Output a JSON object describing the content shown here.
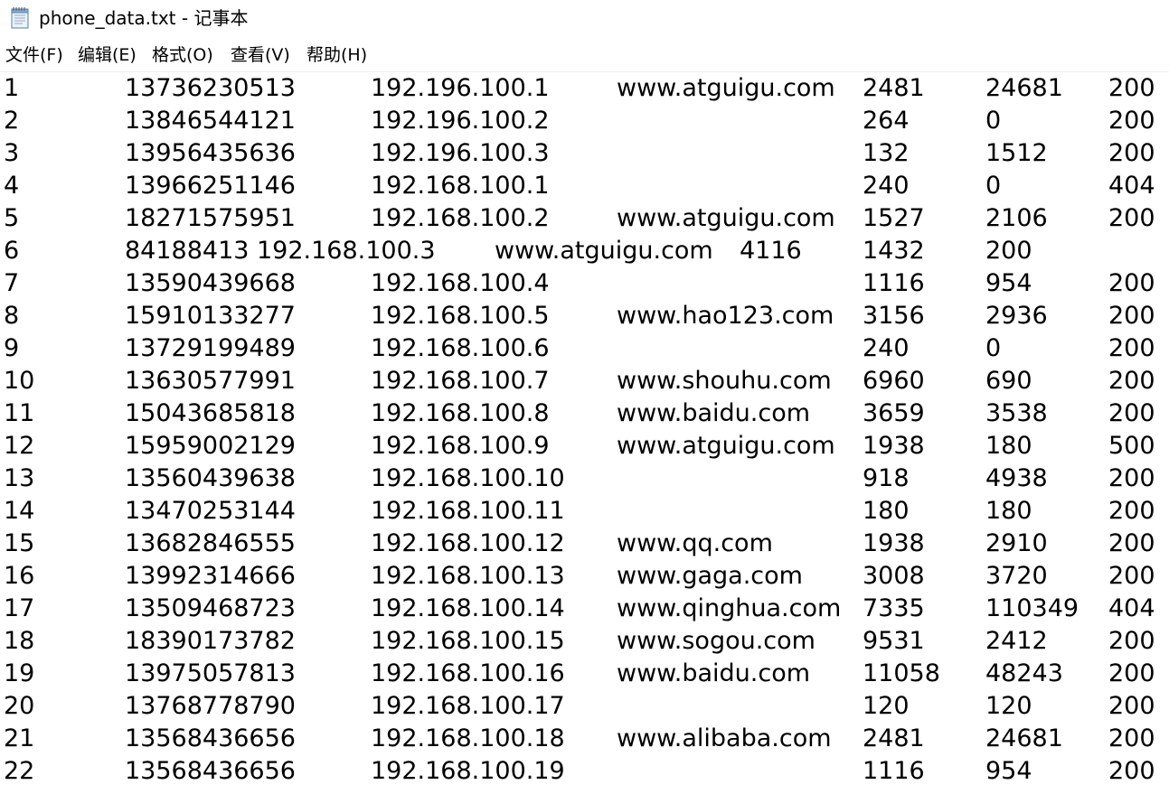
{
  "window": {
    "title": "phone_data.txt - 记事本",
    "icon": "notepad-icon"
  },
  "menu": {
    "items": [
      "文件(F)",
      "编辑(E)",
      "格式(O)",
      "查看(V)",
      "帮助(H)"
    ]
  },
  "content": {
    "rows": [
      [
        "1",
        "13736230513",
        "192.196.100.1",
        "www.atguigu.com",
        "2481",
        "24681",
        "200"
      ],
      [
        "2",
        "13846544121",
        "192.196.100.2",
        "",
        "264",
        "0",
        "200"
      ],
      [
        "3",
        "13956435636",
        "192.196.100.3",
        "",
        "132",
        "1512",
        "200"
      ],
      [
        "4",
        "13966251146",
        "192.168.100.1",
        "",
        "240",
        "0",
        "404"
      ],
      [
        "5",
        "18271575951",
        "192.168.100.2",
        "www.atguigu.com",
        "1527",
        "2106",
        "200"
      ],
      [
        "6",
        "84188413 192.168.100.3",
        "www.atguigu.com",
        "4116",
        "1432",
        "200"
      ],
      [
        "7",
        "13590439668",
        "192.168.100.4",
        "",
        "1116",
        "954",
        "200"
      ],
      [
        "8",
        "15910133277",
        "192.168.100.5",
        "www.hao123.com",
        "3156",
        "2936",
        "200"
      ],
      [
        "9",
        "13729199489",
        "192.168.100.6",
        "",
        "240",
        "0",
        "200"
      ],
      [
        "10",
        "13630577991",
        "192.168.100.7",
        "www.shouhu.com",
        "6960",
        "690",
        "200"
      ],
      [
        "11",
        "15043685818",
        "192.168.100.8",
        "www.baidu.com",
        "3659",
        "3538",
        "200"
      ],
      [
        "12",
        "15959002129",
        "192.168.100.9",
        "www.atguigu.com",
        "1938",
        "180",
        "500"
      ],
      [
        "13",
        "13560439638",
        "192.168.100.10",
        "",
        "918",
        "4938",
        "200"
      ],
      [
        "14",
        "13470253144",
        "192.168.100.11",
        "",
        "180",
        "180",
        "200"
      ],
      [
        "15",
        "13682846555",
        "192.168.100.12",
        "www.qq.com",
        "1938",
        "2910",
        "200"
      ],
      [
        "16",
        "13992314666",
        "192.168.100.13",
        "www.gaga.com",
        "3008",
        "3720",
        "200"
      ],
      [
        "17",
        "13509468723",
        "192.168.100.14",
        "www.qinghua.com",
        "7335",
        "110349",
        "404"
      ],
      [
        "18",
        "18390173782",
        "192.168.100.15",
        "www.sogou.com",
        "9531",
        "2412",
        "200"
      ],
      [
        "19",
        "13975057813",
        "192.168.100.16",
        "www.baidu.com",
        "11058",
        "48243",
        "200"
      ],
      [
        "20",
        "13768778790",
        "192.168.100.17",
        "",
        "120",
        "120",
        "200"
      ],
      [
        "21",
        "13568436656",
        "192.168.100.18",
        "www.alibaba.com",
        "2481",
        "24681",
        "200"
      ],
      [
        "22",
        "13568436656",
        "192.168.100.19",
        "",
        "1116",
        "954",
        "200"
      ]
    ]
  }
}
